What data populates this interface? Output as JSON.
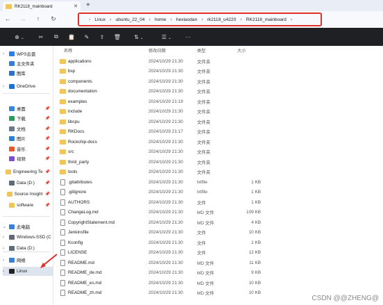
{
  "tab": {
    "title": "RK2118_mainboard",
    "close": "✕",
    "new": "+"
  },
  "nav": {
    "back": "←",
    "forward": "→",
    "up": "↑",
    "refresh": "↻"
  },
  "breadcrumb": [
    "Linux",
    "ubuntu_22_04",
    "home",
    "hexiaodan",
    "rk2118_u4220",
    "RK2118_mainboard"
  ],
  "colors": {
    "highlight_box": "#e0302c",
    "folder": "#f2c55c",
    "command_bar": "#1f2023"
  },
  "commandbar": {
    "new_label": "⊕",
    "cut": "✂",
    "copy": "⧉",
    "paste": "📋",
    "rename": "✎",
    "share": "⇪",
    "delete": "🗑",
    "sort": "⇅",
    "view": "☰",
    "more": "···"
  },
  "columns": {
    "name": "名称",
    "date": "修改日期",
    "type": "类型",
    "size": "大小"
  },
  "sidebar": {
    "items": [
      {
        "label": "WPS云盘",
        "icon": "cloud-icon",
        "color": "#2e7de9",
        "chev": "›"
      },
      {
        "label": "主文件夹",
        "icon": "home-icon",
        "color": "#3a7bd5",
        "chev": ""
      },
      {
        "label": "图库",
        "icon": "gallery-icon",
        "color": "#2f6fd0",
        "chev": ""
      },
      {
        "label": "OneDrive",
        "icon": "onedrive-icon",
        "color": "#1f6fd8",
        "chev": "›"
      },
      {
        "label": "桌面",
        "icon": "desktop-icon",
        "color": "#3a86d8",
        "chev": "",
        "pin": "📌"
      },
      {
        "label": "下载",
        "icon": "download-icon",
        "color": "#2e9a5a",
        "chev": "",
        "pin": "📌"
      },
      {
        "label": "文档",
        "icon": "documents-icon",
        "color": "#6a7a8c",
        "chev": "",
        "pin": "📌"
      },
      {
        "label": "图片",
        "icon": "pictures-icon",
        "color": "#2f7fd0",
        "chev": "",
        "pin": "📌"
      },
      {
        "label": "音乐",
        "icon": "music-icon",
        "color": "#e25a2b",
        "chev": "",
        "pin": "📌"
      },
      {
        "label": "视频",
        "icon": "videos-icon",
        "color": "#7b4fc9",
        "chev": "",
        "pin": "📌"
      },
      {
        "label": "Engineering Te",
        "icon": "folder-icon",
        "color": "#f2c55c",
        "chev": "",
        "pin": "📌"
      },
      {
        "label": "Data (D:)",
        "icon": "drive-icon",
        "color": "#5f6b78",
        "chev": "",
        "pin": "📌"
      },
      {
        "label": "Source Insight",
        "icon": "folder-icon",
        "color": "#f2c55c",
        "chev": "",
        "pin": "📌"
      },
      {
        "label": "software",
        "icon": "folder-icon",
        "color": "#f2c55c",
        "chev": "",
        "pin": "📌"
      },
      {
        "label": "此电脑",
        "icon": "computer-icon",
        "color": "#3b7fd6",
        "chev": "⌄"
      },
      {
        "label": "Windows-SSD (C",
        "icon": "drive-icon",
        "color": "#5f6b78",
        "chev": "›"
      },
      {
        "label": "Data (D:)",
        "icon": "drive-icon",
        "color": "#5f6b78",
        "chev": "›"
      },
      {
        "label": "网络",
        "icon": "network-icon",
        "color": "#3b7fd6",
        "chev": "›"
      },
      {
        "label": "Linux",
        "icon": "linux-penguin-icon",
        "color": "#222222",
        "chev": "›"
      }
    ]
  },
  "files": [
    {
      "name": "applications",
      "date": "2024/10/29 21:30",
      "type": "文件夹",
      "size": "",
      "kind": "folder"
    },
    {
      "name": "bsp",
      "date": "2024/10/29 21:30",
      "type": "文件夹",
      "size": "",
      "kind": "folder"
    },
    {
      "name": "components",
      "date": "2024/10/29 21:30",
      "type": "文件夹",
      "size": "",
      "kind": "folder"
    },
    {
      "name": "documentation",
      "date": "2024/10/29 21:30",
      "type": "文件夹",
      "size": "",
      "kind": "folder"
    },
    {
      "name": "examples",
      "date": "2024/10/29 21:19",
      "type": "文件夹",
      "size": "",
      "kind": "folder"
    },
    {
      "name": "include",
      "date": "2024/10/29 21:30",
      "type": "文件夹",
      "size": "",
      "kind": "folder"
    },
    {
      "name": "libcpu",
      "date": "2024/10/29 21:30",
      "type": "文件夹",
      "size": "",
      "kind": "folder"
    },
    {
      "name": "RKDocs",
      "date": "2024/10/29 21:17",
      "type": "文件夹",
      "size": "",
      "kind": "folder"
    },
    {
      "name": "Rockchip-docs",
      "date": "2024/10/29 21:30",
      "type": "文件夹",
      "size": "",
      "kind": "folder"
    },
    {
      "name": "src",
      "date": "2024/10/29 21:30",
      "type": "文件夹",
      "size": "",
      "kind": "folder"
    },
    {
      "name": "third_party",
      "date": "2024/10/29 21:30",
      "type": "文件夹",
      "size": "",
      "kind": "folder"
    },
    {
      "name": "tools",
      "date": "2024/10/29 21:30",
      "type": "文件夹",
      "size": "",
      "kind": "folder"
    },
    {
      "name": ".gitattributes",
      "date": "2024/10/29 21:30",
      "type": "txtfile",
      "size": "1 KB",
      "kind": "file"
    },
    {
      "name": ".gitignore",
      "date": "2024/10/29 21:30",
      "type": "txtfile",
      "size": "1 KB",
      "kind": "file"
    },
    {
      "name": "AUTHORS",
      "date": "2024/10/29 21:30",
      "type": "文件",
      "size": "1 KB",
      "kind": "file"
    },
    {
      "name": "ChangeLog.md",
      "date": "2024/10/29 21:30",
      "type": "MD 文件",
      "size": "109 KB",
      "kind": "file"
    },
    {
      "name": "CopyrightStatement.md",
      "date": "2024/10/29 21:30",
      "type": "MD 文件",
      "size": "4 KB",
      "kind": "file"
    },
    {
      "name": "Jenkinsfile",
      "date": "2024/10/29 21:30",
      "type": "文件",
      "size": "10 KB",
      "kind": "file"
    },
    {
      "name": "Kconfig",
      "date": "2024/10/29 21:30",
      "type": "文件",
      "size": "1 KB",
      "kind": "file"
    },
    {
      "name": "LICENSE",
      "date": "2024/10/29 21:30",
      "type": "文件",
      "size": "12 KB",
      "kind": "file"
    },
    {
      "name": "README.md",
      "date": "2024/10/29 21:30",
      "type": "MD 文件",
      "size": "11 KB",
      "kind": "file"
    },
    {
      "name": "README_de.md",
      "date": "2024/10/29 21:30",
      "type": "MD 文件",
      "size": "9 KB",
      "kind": "file"
    },
    {
      "name": "README_es.md",
      "date": "2024/10/29 21:30",
      "type": "MD 文件",
      "size": "10 KB",
      "kind": "file"
    },
    {
      "name": "README_zh.md",
      "date": "2024/10/29 21:30",
      "type": "MD 文件",
      "size": "10 KB",
      "kind": "file"
    }
  ],
  "watermark": "CSDN @@ZHENG@"
}
